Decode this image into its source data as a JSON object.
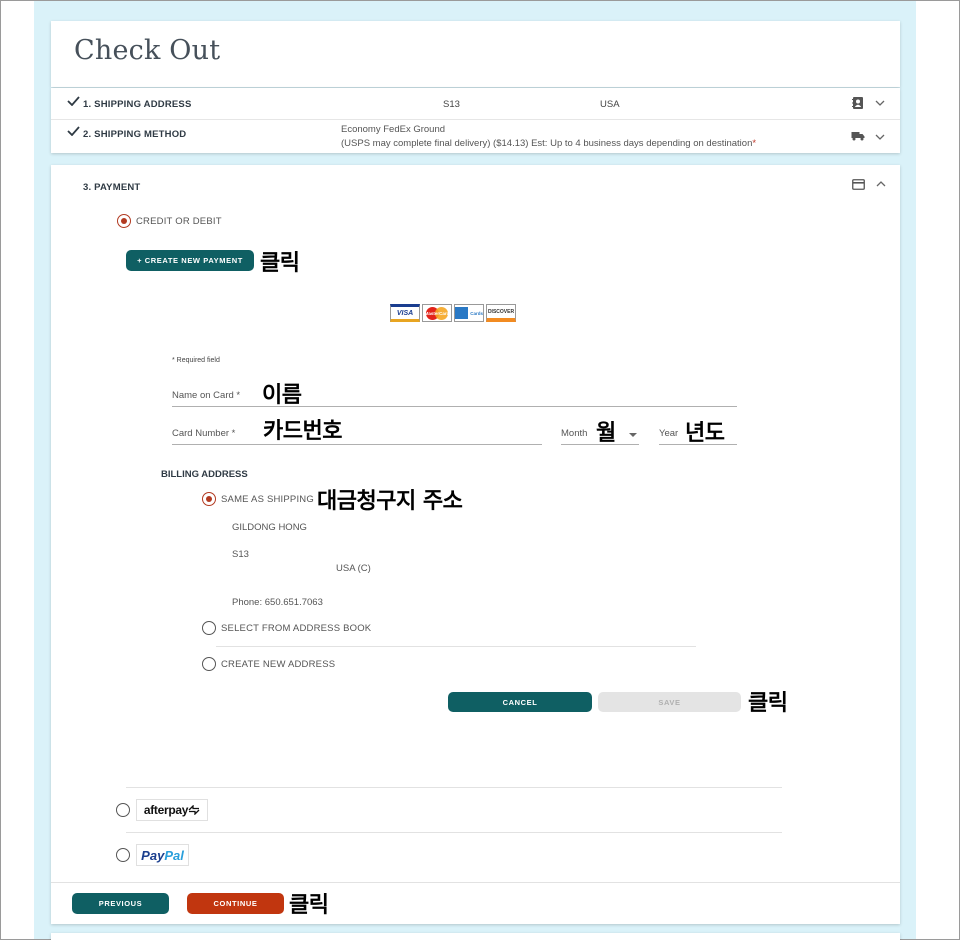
{
  "page": {
    "title": "Check Out"
  },
  "steps": [
    {
      "label": "1. SHIPPING ADDRESS",
      "value1": "S13",
      "value2": "USA",
      "icon": "address-book-icon"
    },
    {
      "label": "2. SHIPPING METHOD",
      "line1": "Economy FedEx Ground",
      "line2": "(USPS may complete final delivery)  ($14.13) Est: Up to 4 business days depending on destination",
      "required_mark": "*",
      "icon": "truck-icon"
    }
  ],
  "payment": {
    "title": "3. PAYMENT",
    "icon": "credit-card-icon",
    "credit_option": "CREDIT OR DEBIT",
    "create_new_payment": "+ CREATE NEW PAYMENT",
    "card_brands": [
      "VISA",
      "MasterCard",
      "Cards",
      "DISCOVER"
    ],
    "required_note": "* Required field",
    "name_on_card": "Name on Card *",
    "card_number": "Card Number *",
    "month": "Month",
    "year": "Year",
    "billing_title": "BILLING ADDRESS",
    "same_as_shipping": "SAME AS SHIPPING",
    "address": {
      "name": "GILDONG HONG",
      "line1": "S13",
      "country": "USA (C)",
      "phone": "Phone: 650.651.7063"
    },
    "select_address_book": "SELECT FROM ADDRESS BOOK",
    "create_new_address": "CREATE NEW ADDRESS",
    "cancel": "CANCEL",
    "save": "SAVE",
    "afterpay": "afterpay",
    "paypal_1": "Pay",
    "paypal_2": "Pal"
  },
  "footer": {
    "previous": "PREVIOUS",
    "continue": "CONTINUE"
  },
  "annotations": {
    "click1": "클릭",
    "name": "이름",
    "card_number": "카드번호",
    "month": "월",
    "year": "년도",
    "billing": "대금청구지  주소",
    "click2": "클릭",
    "click3": "클릭"
  },
  "colors": {
    "teal": "#0f5f63",
    "orange": "#c1360f",
    "radio_selected": "#b23a21",
    "background": "#daf2f9"
  }
}
